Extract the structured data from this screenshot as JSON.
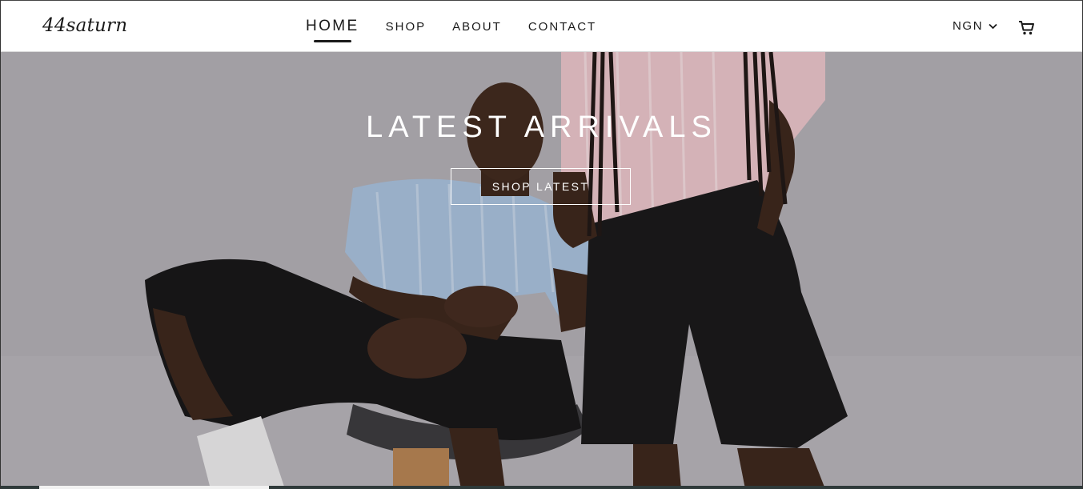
{
  "header": {
    "logo": "44saturn",
    "nav": [
      {
        "label": "HOME",
        "active": true
      },
      {
        "label": "SHOP",
        "active": false
      },
      {
        "label": "ABOUT",
        "active": false
      },
      {
        "label": "CONTACT",
        "active": false
      }
    ],
    "currency": "NGN",
    "icons": {
      "currency_dropdown": "chevron-down-icon",
      "cart": "cart-icon"
    }
  },
  "hero": {
    "title": "LATEST ARRIVALS",
    "cta_label": "SHOP LATEST",
    "slide_indicator": {
      "active_index": 0
    }
  },
  "colors": {
    "text_dark": "#1a1a1a",
    "hero_background": "#b4b2b6",
    "hero_text": "#ffffff",
    "shorts": "#151515",
    "shirt_blue": "#a9c3de",
    "shirt_pink": "#ecc6cb"
  }
}
